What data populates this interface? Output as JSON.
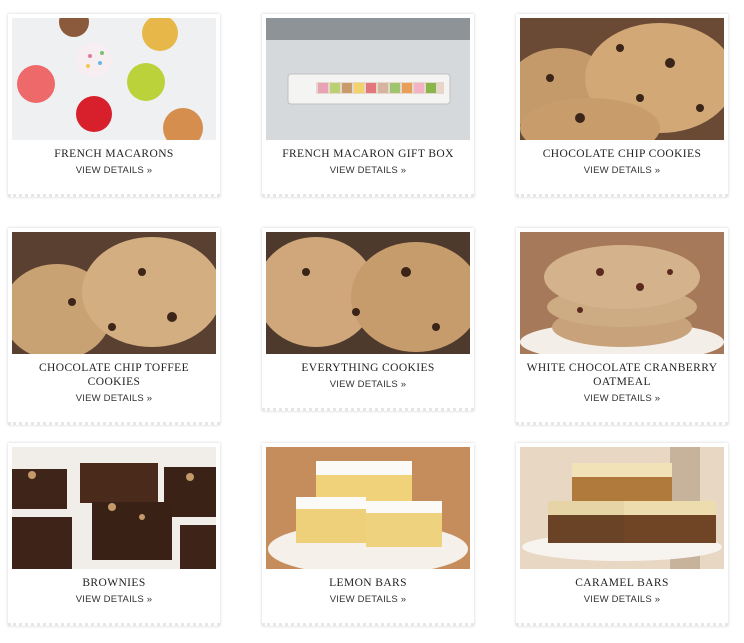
{
  "products": [
    {
      "title": "FRENCH MACARONS",
      "link": "VIEW DETAILS »",
      "image": "macarons-photo"
    },
    {
      "title": "FRENCH MACARON GIFT BOX",
      "link": "VIEW DETAILS »",
      "image": "macaron-gift-box-photo"
    },
    {
      "title": "CHOCOLATE CHIP COOKIES",
      "link": "VIEW DETAILS »",
      "image": "chocolate-chip-cookies-photo"
    },
    {
      "title": "CHOCOLATE CHIP TOFFEE COOKIES",
      "link": "VIEW DETAILS »",
      "image": "toffee-cookies-photo"
    },
    {
      "title": "EVERYTHING COOKIES",
      "link": "VIEW DETAILS »",
      "image": "everything-cookies-photo"
    },
    {
      "title": "WHITE CHOCOLATE CRANBERRY OATMEAL",
      "link": "VIEW DETAILS »",
      "image": "cranberry-oatmeal-photo"
    },
    {
      "title": "BROWNIES",
      "link": "VIEW DETAILS »",
      "image": "brownies-photo"
    },
    {
      "title": "LEMON BARS",
      "link": "VIEW DETAILS »",
      "image": "lemon-bars-photo"
    },
    {
      "title": "CARAMEL BARS",
      "link": "VIEW DETAILS »",
      "image": "caramel-bars-photo"
    }
  ]
}
